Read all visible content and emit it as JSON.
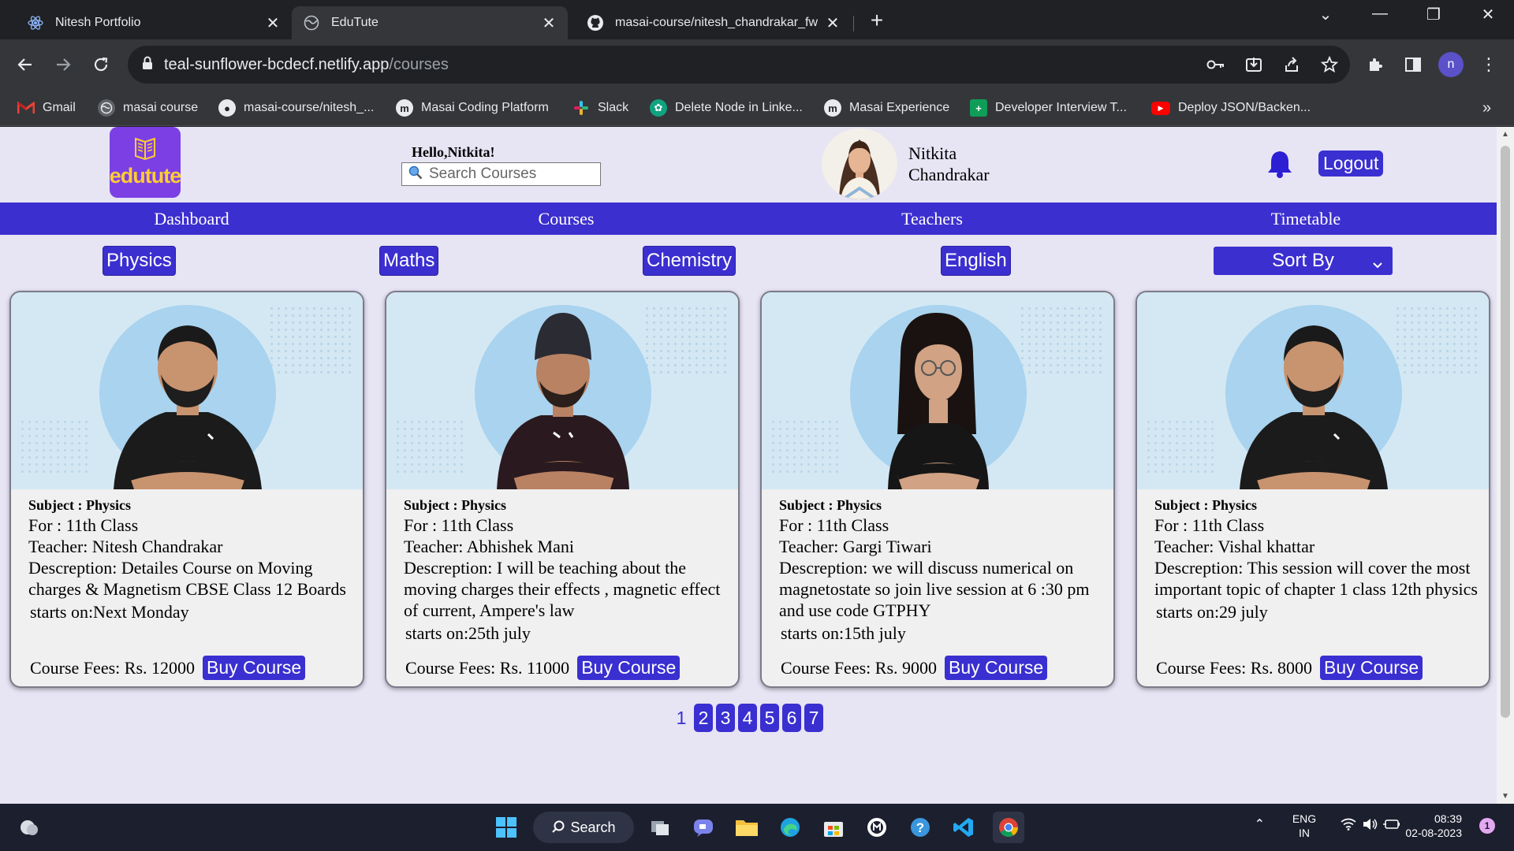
{
  "browser": {
    "tabs": [
      {
        "title": "Nitesh Portfolio",
        "icon": "react-icon",
        "active": false
      },
      {
        "title": "EduTute",
        "icon": "globe-icon",
        "active": true
      },
      {
        "title": "masai-course/nitesh_chandrakar_fw",
        "icon": "github-icon",
        "active": false
      }
    ],
    "url_host": "teal-sunflower-bcdecf.netlify.app",
    "url_path": "/courses",
    "profile_initial": "n",
    "bookmarks": [
      {
        "label": "Gmail",
        "icon": "gmail-icon"
      },
      {
        "label": "masai course",
        "icon": "globe-icon"
      },
      {
        "label": "masai-course/nitesh_...",
        "icon": "github-icon"
      },
      {
        "label": "Masai Coding Platform",
        "icon": "masai-icon"
      },
      {
        "label": "Slack",
        "icon": "slack-icon"
      },
      {
        "label": "Delete Node in Linke...",
        "icon": "chatgpt-icon"
      },
      {
        "label": "Masai Experience",
        "icon": "masai-icon"
      },
      {
        "label": "Developer Interview T...",
        "icon": "sheets-icon"
      },
      {
        "label": "Deploy JSON/Backen...",
        "icon": "youtube-icon"
      }
    ],
    "bookmarks_overflow": "»"
  },
  "header": {
    "logo_text": "edutute",
    "greeting": "Hello,Nitkita!",
    "search_placeholder": "Search Courses",
    "user_first": "Nitkita",
    "user_last": "Chandrakar",
    "logout_label": "Logout"
  },
  "nav": [
    "Dashboard",
    "Courses",
    "Teachers",
    "Timetable"
  ],
  "filters": [
    "Physics",
    "Maths",
    "Chemistry",
    "English"
  ],
  "sort_label": "Sort By",
  "courses": [
    {
      "subject": "Subject : Physics",
      "for": "For : 11th Class",
      "teacher": "Teacher: Nitesh Chandrakar",
      "description": "Descreption: Detailes Course on Moving charges & Magnetism CBSE Class 12 Boards",
      "starts": "starts on:Next Monday",
      "fees": "Course Fees: Rs. 12000",
      "buy_label": "Buy Course",
      "shirt": "#1b1b1b"
    },
    {
      "subject": "Subject : Physics",
      "for": "For : 11th Class",
      "teacher": "Teacher: Abhishek Mani",
      "description": "Descreption: I will be teaching about the moving charges their effects , magnetic effect of current, Ampere's law",
      "starts": "starts on:25th july",
      "fees": "Course Fees: Rs. 11000",
      "buy_label": "Buy Course",
      "shirt": "#2a1a1f"
    },
    {
      "subject": "Subject : Physics",
      "for": "For : 11th Class",
      "teacher": "Teacher: Gargi Tiwari",
      "description": "Descreption: we will discuss numerical on magnetostate so join live session at 6 :30 pm and use code GTPHY",
      "starts": "starts on:15th july",
      "fees": "Course Fees: Rs. 9000",
      "buy_label": "Buy Course",
      "shirt": "#161616"
    },
    {
      "subject": "Subject : Physics",
      "for": "For : 11th Class",
      "teacher": "Teacher: Vishal khattar",
      "description": "Descreption: This session will cover the most important topic of chapter 1 class 12th physics",
      "starts": "starts on:29 july",
      "fees": "Course Fees: Rs. 8000",
      "buy_label": "Buy Course",
      "shirt": "#1b1b1b"
    }
  ],
  "pagination": {
    "current": "1",
    "pages": [
      "2",
      "3",
      "4",
      "5",
      "6",
      "7"
    ]
  },
  "taskbar": {
    "search_label": "Search",
    "lang_top": "ENG",
    "lang_bottom": "IN",
    "time": "08:39",
    "date": "02-08-2023",
    "notification_count": "1"
  },
  "colors": {
    "accent": "#3b2fd0",
    "page_bg": "#e7e4f4",
    "logo_bg": "#7b3fe4",
    "bell": "#2d1fd4"
  }
}
